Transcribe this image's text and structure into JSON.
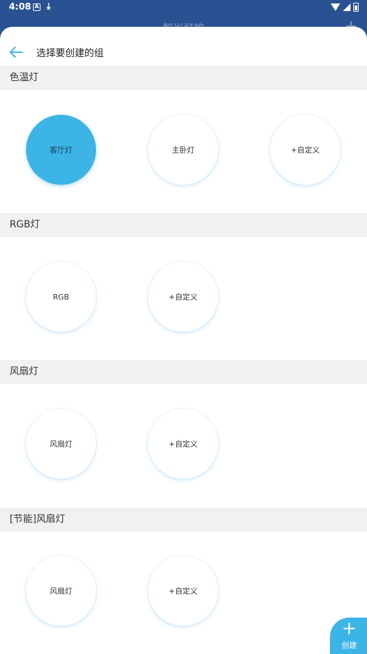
{
  "status_bar": {
    "time": "4:08",
    "notification_icon_a": "A",
    "notification_icon_download": "⤓"
  },
  "background": {
    "title": "智光灯控",
    "add_icon": "+"
  },
  "sheet": {
    "title": "选择要创建的组",
    "back_icon": "arrow-left-icon",
    "accent_color": "#3cb4e6"
  },
  "sections": [
    {
      "title": "色温灯",
      "items": [
        {
          "label": "客厅灯",
          "selected": true
        },
        {
          "label": "主卧灯",
          "selected": false
        },
        {
          "label": "+自定义",
          "selected": false
        }
      ]
    },
    {
      "title": "RGB灯",
      "items": [
        {
          "label": "RGB",
          "selected": false
        },
        {
          "label": "+自定义",
          "selected": false
        }
      ]
    },
    {
      "title": "风扇灯",
      "items": [
        {
          "label": "风扇灯",
          "selected": false
        },
        {
          "label": "+自定义",
          "selected": false
        }
      ]
    },
    {
      "title": "[节能]风扇灯",
      "items": [
        {
          "label": "风扇灯",
          "selected": false
        },
        {
          "label": "+自定义",
          "selected": false
        }
      ]
    }
  ],
  "fab": {
    "icon": "+",
    "label": "创建"
  }
}
